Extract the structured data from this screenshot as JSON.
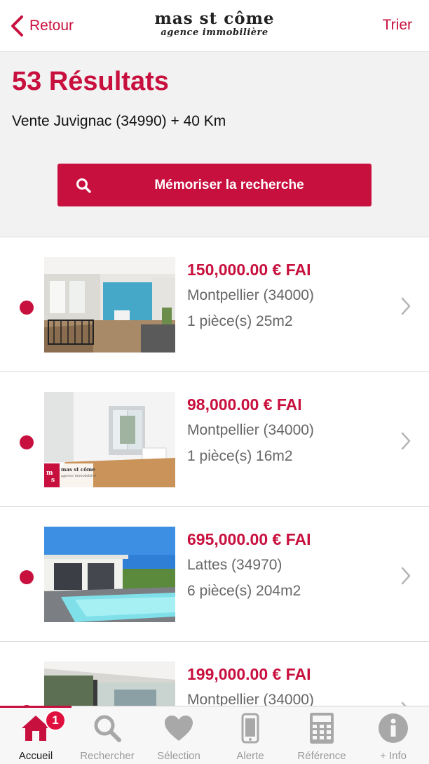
{
  "header": {
    "back_label": "Retour",
    "logo_line1": "mas st côme",
    "logo_line2": "agence immobilière",
    "sort_label": "Trier"
  },
  "results": {
    "title": "53 Résultats",
    "subtitle": "Vente Juvignac (34990) + 40 Km",
    "save_label": "Mémoriser la recherche"
  },
  "listings": [
    {
      "price": "150,000.00 € FAI",
      "city": "Montpellier (34000)",
      "rooms": "1 pièce(s) 25m2"
    },
    {
      "price": "98,000.00 € FAI",
      "city": "Montpellier (34000)",
      "rooms": "1 pièce(s) 16m2",
      "watermark_line1": "mas st côme",
      "watermark_line2": "agence immobilière"
    },
    {
      "price": "695,000.00 € FAI",
      "city": "Lattes (34970)",
      "rooms": "6 pièce(s) 204m2"
    },
    {
      "price": "199,000.00 € FAI",
      "city": "Montpellier (34000)",
      "rooms": ""
    }
  ],
  "tabbar": {
    "tabs": [
      {
        "label": "Accueil",
        "icon": "home-icon",
        "badge": "1",
        "active": true
      },
      {
        "label": "Rechercher",
        "icon": "search-icon"
      },
      {
        "label": "Sélection",
        "icon": "heart-icon"
      },
      {
        "label": "Alerte",
        "icon": "phone-icon"
      },
      {
        "label": "Référence",
        "icon": "calculator-icon"
      },
      {
        "label": "+ Info",
        "icon": "info-icon"
      }
    ]
  },
  "colors": {
    "accent": "#c8103e",
    "badge": "#e0103e",
    "muted_text": "#666666",
    "tab_inactive": "#9a9a9a"
  }
}
